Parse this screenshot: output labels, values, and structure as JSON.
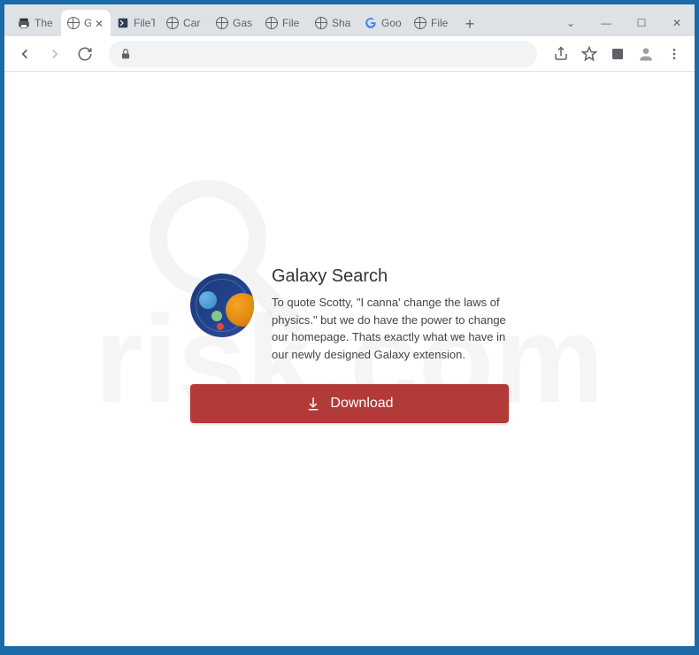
{
  "tabs": [
    {
      "title": "The ",
      "type": "printer"
    },
    {
      "title": "G",
      "type": "globe",
      "active": true
    },
    {
      "title": "FileT",
      "type": "file"
    },
    {
      "title": "Car ",
      "type": "globe"
    },
    {
      "title": "Gas",
      "type": "globe"
    },
    {
      "title": "File ",
      "type": "globe"
    },
    {
      "title": "Sha",
      "type": "globe"
    },
    {
      "title": "Goo",
      "type": "google"
    },
    {
      "title": "File ",
      "type": "globe"
    }
  ],
  "window_controls": {
    "dropdown": "⌄",
    "minimize": "—",
    "maximize": "☐",
    "close": "✕"
  },
  "toolbar": {
    "new_tab": "+"
  },
  "page": {
    "heading": "Galaxy Search",
    "description": "To quote Scotty, \"I canna' change the laws of physics.\" but we do have the power to change our homepage. Thats exactly what we have in our newly designed Galaxy extension.",
    "download_label": "Download"
  },
  "watermark": {
    "text": "risk.com"
  }
}
